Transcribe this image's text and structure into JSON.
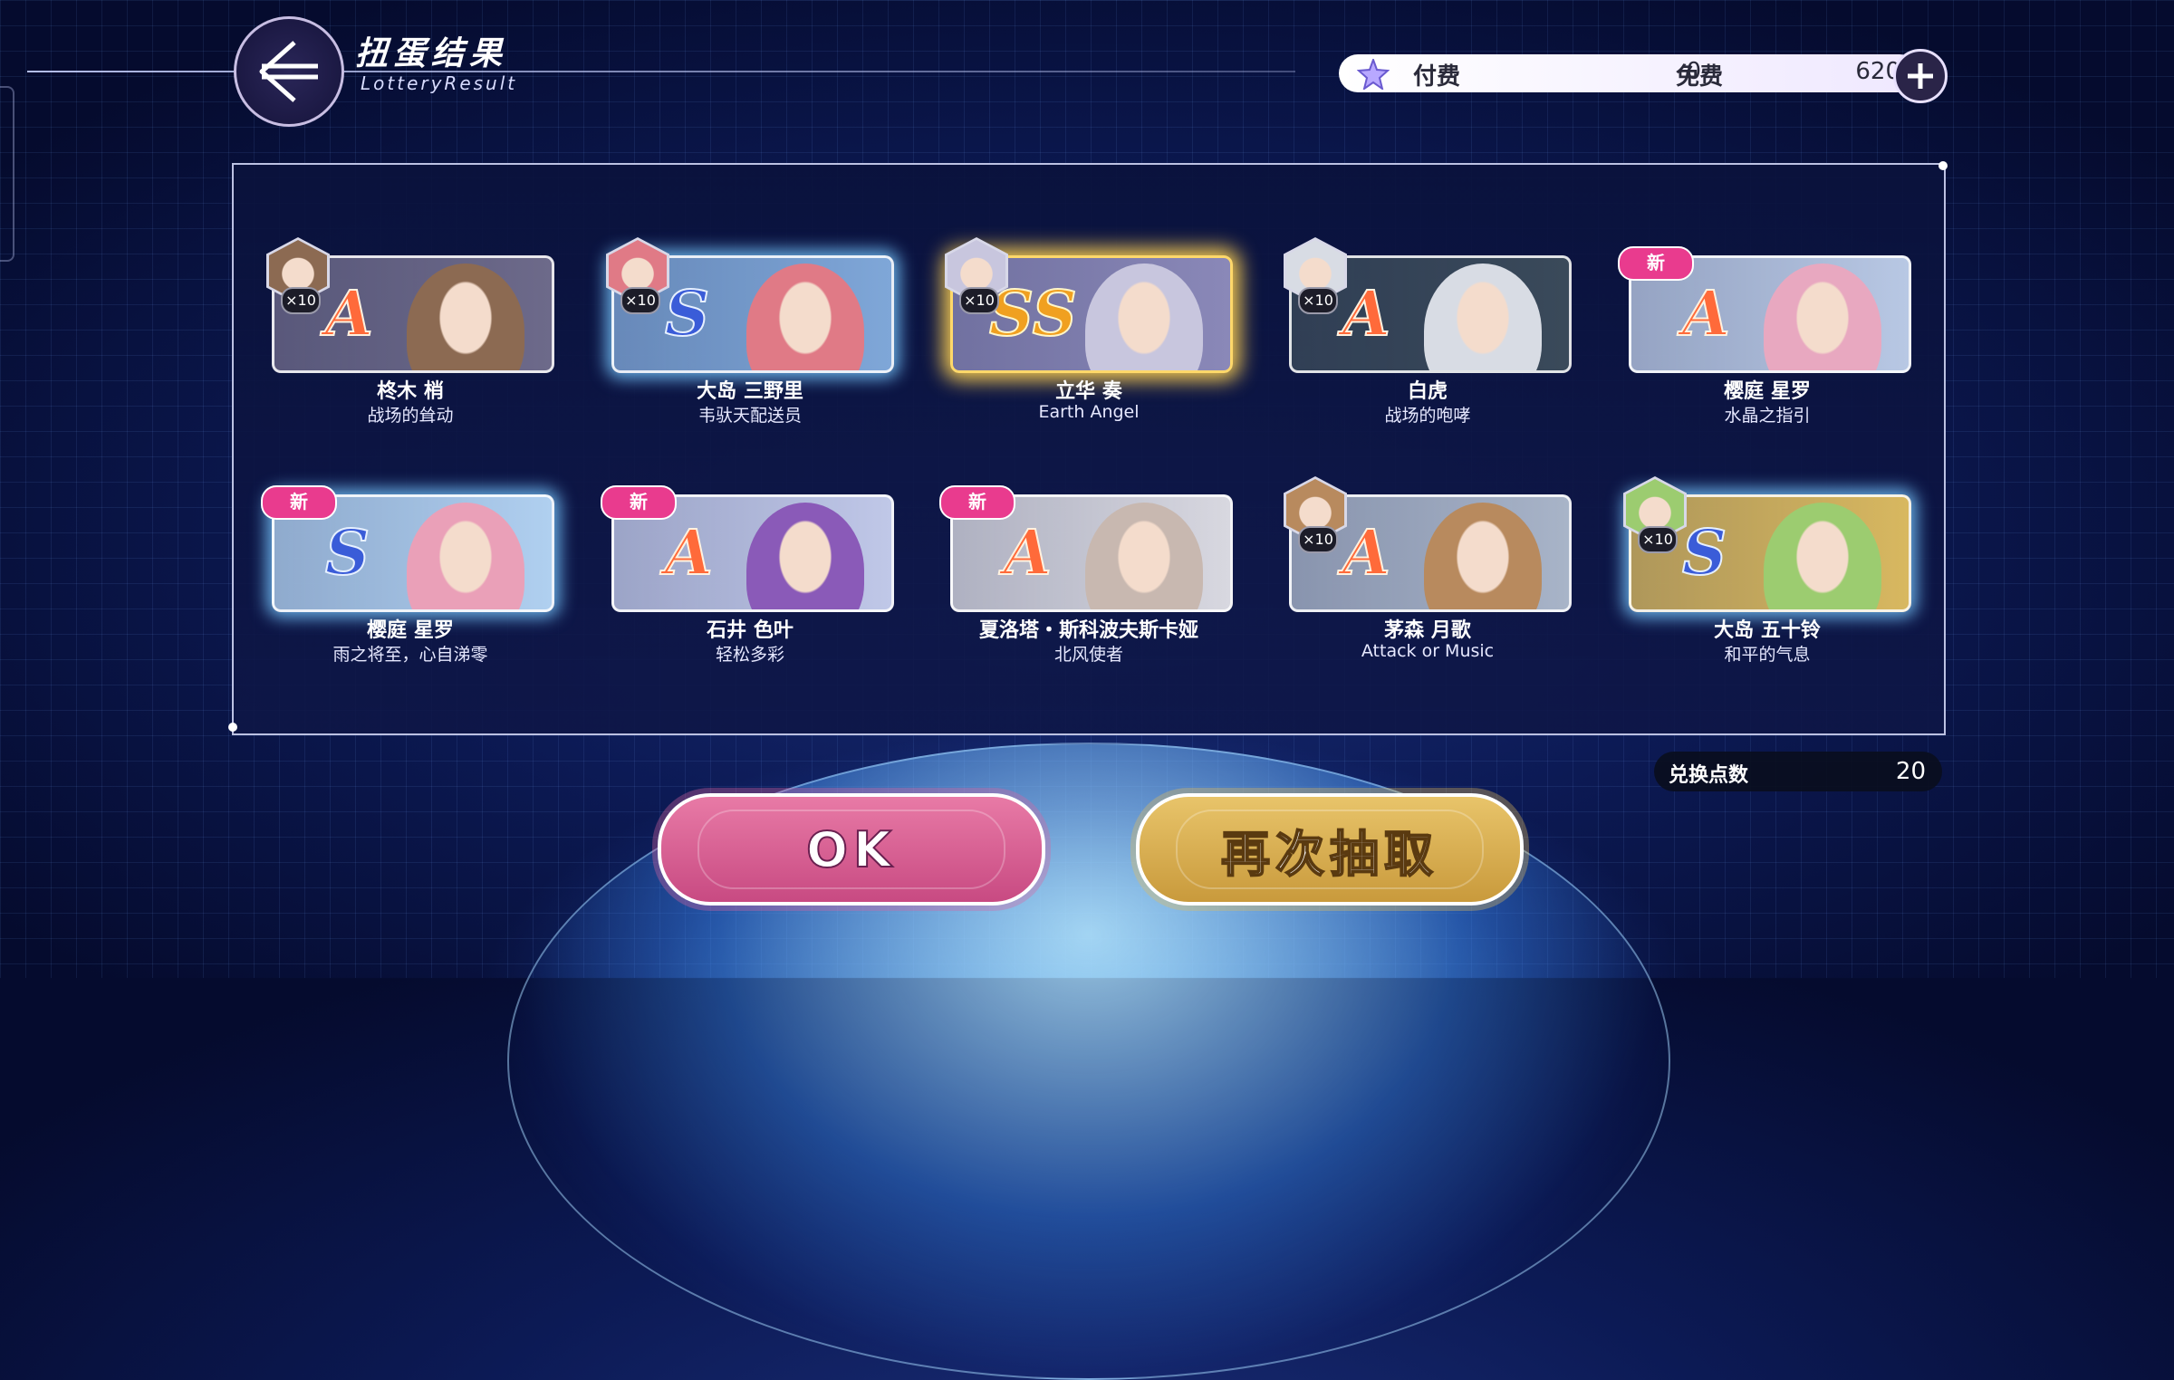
{
  "header": {
    "title_cn": "扭蛋结果",
    "title_en": "LotteryResult"
  },
  "currency": {
    "paid_label": "付费",
    "paid_value": "0",
    "free_label": "免费",
    "free_value": "620"
  },
  "results": [
    {
      "name": "柊木 梢",
      "sub": "战场的耸动",
      "rank": "A",
      "badge": "×10",
      "new": "",
      "bg": "#6d6a8a",
      "face": "#8c6a52"
    },
    {
      "name": "大岛 三野里",
      "sub": "韦驮天配送员",
      "rank": "S",
      "badge": "×10",
      "new": "",
      "bg": "#7fa7d8",
      "face": "#e07a86"
    },
    {
      "name": "立华 奏",
      "sub": "Earth Angel",
      "rank": "SS",
      "badge": "×10",
      "new": "",
      "bg": "#8a88b8",
      "face": "#c8c6de"
    },
    {
      "name": "白虎",
      "sub": "战场的咆哮",
      "rank": "A",
      "badge": "×10",
      "new": "",
      "bg": "#3a4a5a",
      "face": "#d8dce4"
    },
    {
      "name": "樱庭 星罗",
      "sub": "水晶之指引",
      "rank": "A",
      "badge": "",
      "new": "新",
      "bg": "#b8c8e4",
      "face": "#e8a8c0"
    },
    {
      "name": "樱庭 星罗",
      "sub": "雨之将至，心自涕零",
      "rank": "S",
      "badge": "",
      "new": "新",
      "bg": "#b0d0f0",
      "face": "#eaa0b8"
    },
    {
      "name": "石井 色叶",
      "sub": "轻松多彩",
      "rank": "A",
      "badge": "",
      "new": "新",
      "bg": "#c0c8e8",
      "face": "#8a5ab8"
    },
    {
      "name": "夏洛塔・斯科波夫斯卡娅",
      "sub": "北风使者",
      "rank": "A",
      "badge": "",
      "new": "新",
      "bg": "#d8d8e0",
      "face": "#c8b8b0"
    },
    {
      "name": "茅森 月歌",
      "sub": "Attack or Music",
      "rank": "A",
      "badge": "×10",
      "new": "",
      "bg": "#a8b4c8",
      "face": "#b88a5e"
    },
    {
      "name": "大岛 五十铃",
      "sub": "和平的气息",
      "rank": "S",
      "badge": "×10",
      "new": "",
      "bg": "#d8b860",
      "face": "#9ccc70"
    }
  ],
  "points": {
    "label": "兑换点数",
    "value": "20"
  },
  "buttons": {
    "ok": "OK",
    "again": "再次抽取"
  }
}
